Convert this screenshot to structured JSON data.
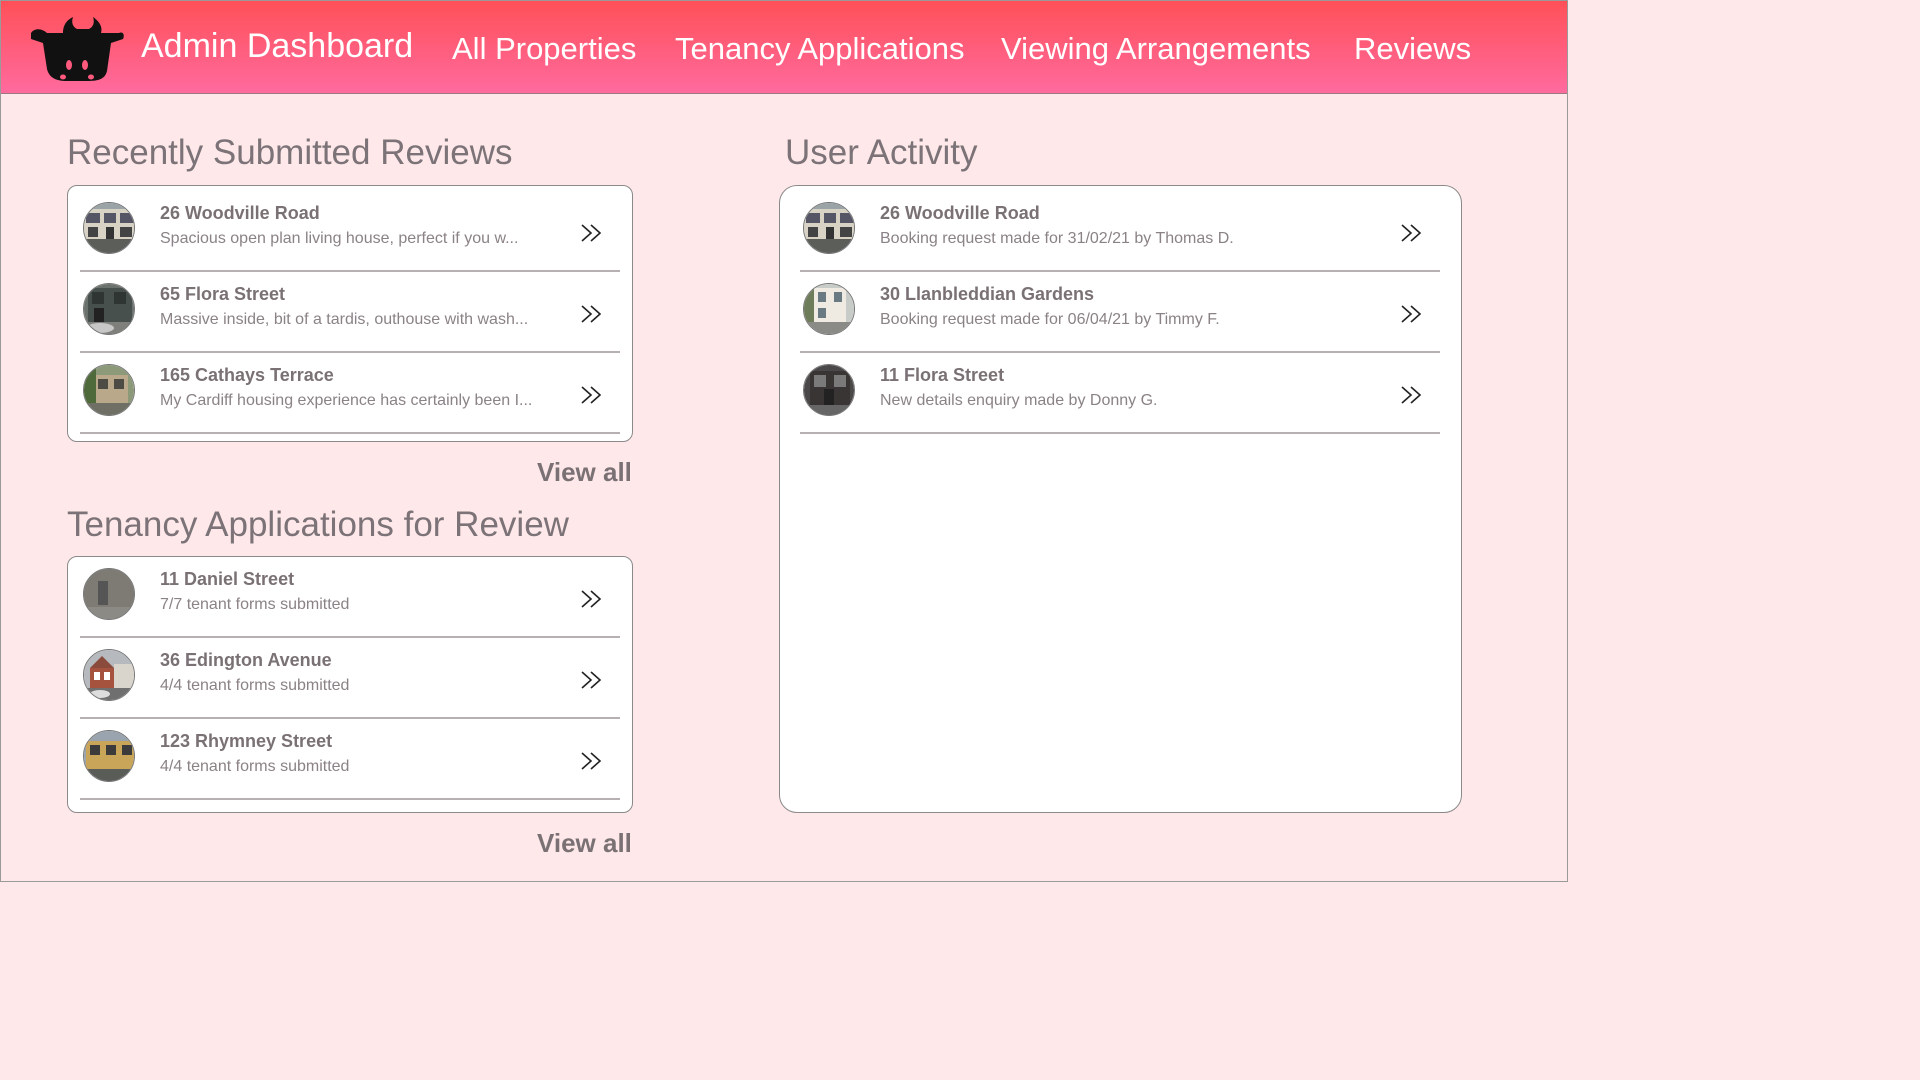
{
  "header": {
    "brand": "Admin Dashboard",
    "nav": [
      "All Properties",
      "Tenancy Applications",
      "Viewing Arrangements",
      "Reviews"
    ]
  },
  "reviews": {
    "title": "Recently Submitted Reviews",
    "items": [
      {
        "title": "26 Woodville Road",
        "subtitle": "Spacious open plan living house, perfect if you w..."
      },
      {
        "title": "65 Flora Street",
        "subtitle": "Massive inside, bit of a tardis, outhouse with wash..."
      },
      {
        "title": "165 Cathays Terrace",
        "subtitle": "My Cardiff housing experience has certainly been I..."
      }
    ],
    "view_all": "View all"
  },
  "applications": {
    "title": "Tenancy Applications for Review",
    "items": [
      {
        "title": "11 Daniel Street",
        "subtitle": "7/7 tenant forms submitted"
      },
      {
        "title": "36 Edington Avenue",
        "subtitle": "4/4 tenant forms submitted"
      },
      {
        "title": "123 Rhymney Street",
        "subtitle": "4/4 tenant forms submitted"
      }
    ],
    "view_all": "View all"
  },
  "activity": {
    "title": "User Activity",
    "items": [
      {
        "title": "26 Woodville Road",
        "subtitle": "Booking request made for 31/02/21 by Thomas D."
      },
      {
        "title": "30 Llanbleddian Gardens",
        "subtitle": "Booking request made for 06/04/21 by Timmy F."
      },
      {
        "title": "11 Flora Street",
        "subtitle": "New details enquiry made by Donny G."
      }
    ]
  },
  "icons": {
    "logo": "cow-logo-icon",
    "row_arrow": "double-chevron-right-icon",
    "thumbnail": "house-photo"
  },
  "colors": {
    "header_top": "#ff5058",
    "header_bottom": "#ff6a9e",
    "page_background": "#ffe8ea",
    "text": "#7a7175"
  }
}
